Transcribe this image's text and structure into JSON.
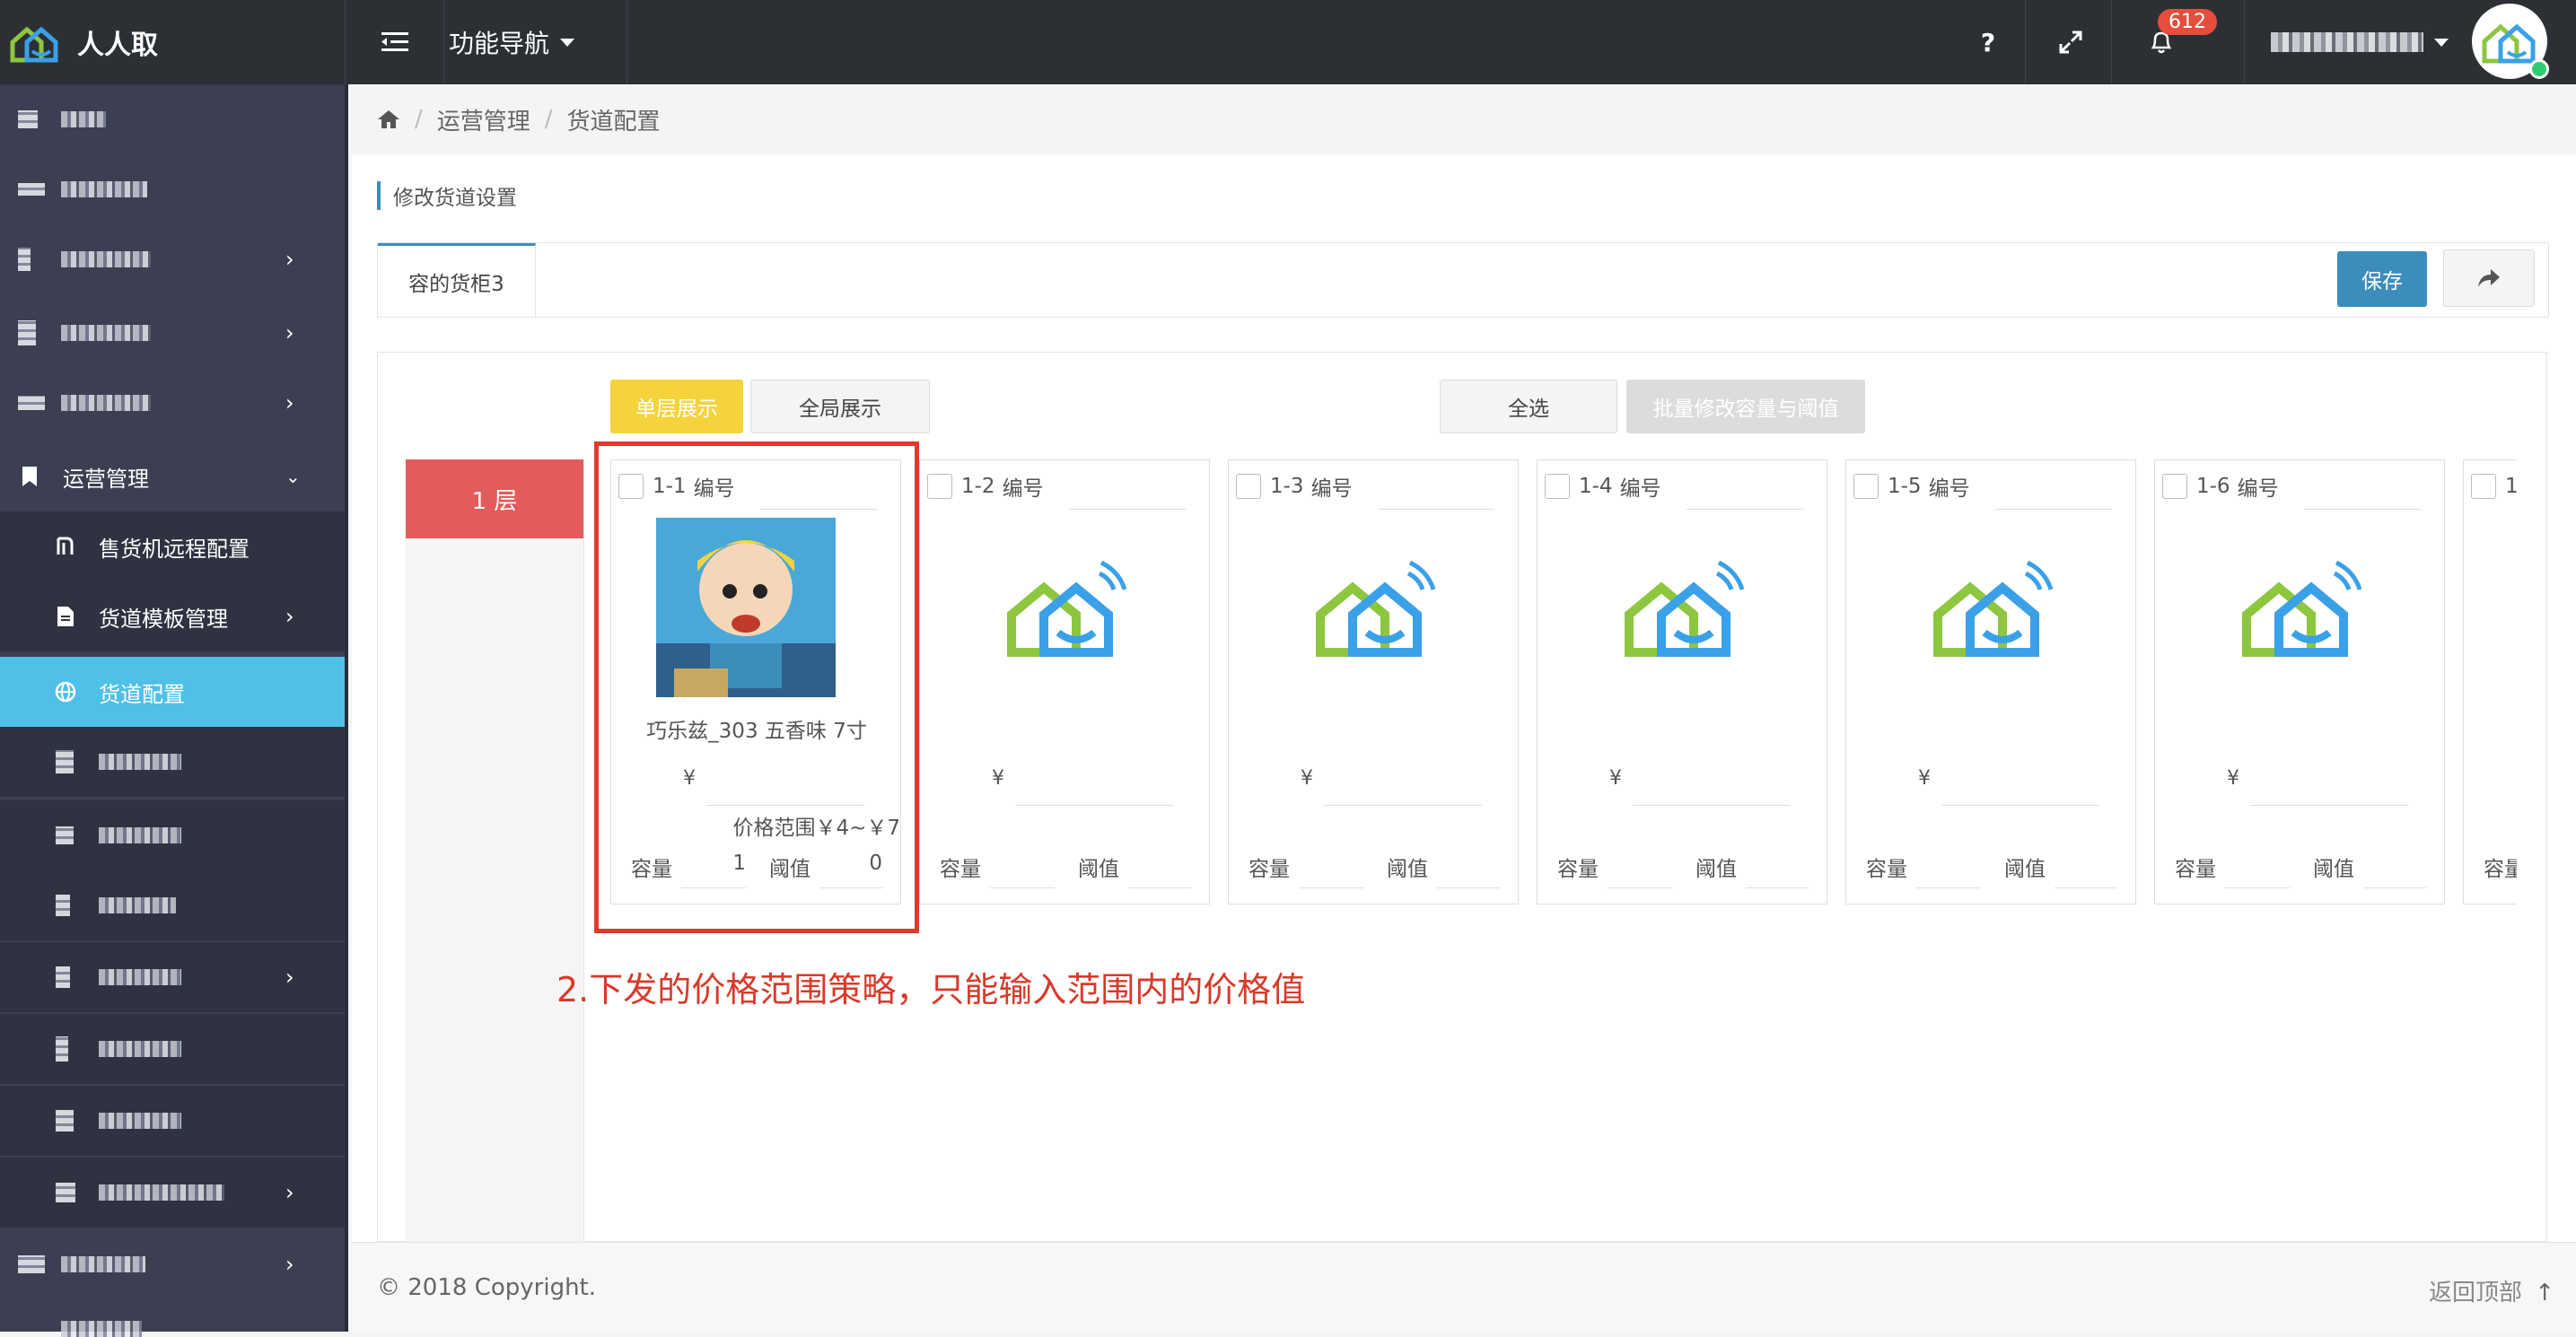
{
  "app": {
    "title": "人人取"
  },
  "topbar": {
    "func_nav_label": "功能导航",
    "help_label": "?",
    "notification_count": "612"
  },
  "sidebar": {
    "section_label": "运营管理",
    "sub_items": [
      {
        "label": "售货机远程配置"
      },
      {
        "label": "货道模板管理"
      },
      {
        "label": "货道配置"
      }
    ]
  },
  "breadcrumb": {
    "items": [
      "运营管理",
      "货道配置"
    ]
  },
  "page": {
    "title": "修改货道设置",
    "tab_label": "容的货柜3",
    "save_label": "保存",
    "buttons": {
      "single_layer": "单层展示",
      "global": "全局展示",
      "select_all": "全选",
      "batch_edit": "批量修改容量与阈值"
    },
    "layer_label": "1 层",
    "labels": {
      "number": "编号",
      "yen": "¥",
      "capacity": "容量",
      "threshold": "阈值"
    },
    "slots": [
      {
        "id": "1-1",
        "product": "巧乐兹_303 五香味 7寸",
        "price_range": "价格范围￥4~￥7",
        "capacity": "1",
        "threshold": "0"
      },
      {
        "id": "1-2"
      },
      {
        "id": "1-3"
      },
      {
        "id": "1-4"
      },
      {
        "id": "1-5"
      },
      {
        "id": "1-6"
      },
      {
        "id": "1-"
      }
    ]
  },
  "annotation": "2.下发的价格范围策略，只能输入范围内的价格值",
  "footer": {
    "copyright": "© 2018 Copyright.",
    "back_to_top": "返回顶部"
  },
  "colors": {
    "accent": "#3c8dbc",
    "active_menu": "#4fc0e8",
    "layer_tag": "#e35b5a",
    "highlight": "#e03a2c",
    "yellow_button": "#f5d33d"
  },
  "icons": [
    "home-icon",
    "bell-icon",
    "expand-icon",
    "menu-toggle-icon",
    "share-icon",
    "globe-icon",
    "document-icon",
    "currency-icon",
    "arrow-up-icon"
  ]
}
